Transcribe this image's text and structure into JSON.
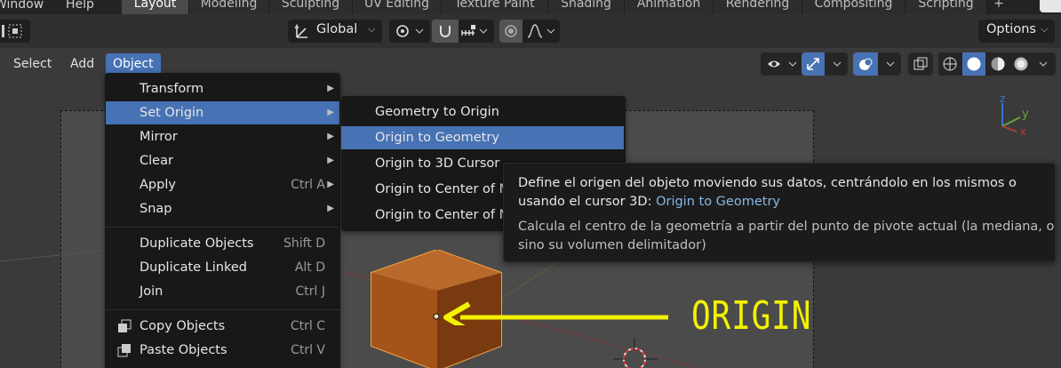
{
  "topbar": {
    "menus": [
      "Window",
      "Help"
    ],
    "workspace_tabs": [
      {
        "label": "Layout",
        "active": true
      },
      {
        "label": "Modeling",
        "active": false
      },
      {
        "label": "Sculpting",
        "active": false
      },
      {
        "label": "UV Editing",
        "active": false
      },
      {
        "label": "Texture Paint",
        "active": false
      },
      {
        "label": "Shading",
        "active": false
      },
      {
        "label": "Animation",
        "active": false
      },
      {
        "label": "Rendering",
        "active": false
      },
      {
        "label": "Compositing",
        "active": false
      },
      {
        "label": "Scripting",
        "active": false
      }
    ],
    "add_tab": "+"
  },
  "header": {
    "orientation": "Global",
    "options": "Options"
  },
  "viewport_menu": [
    "Select",
    "Add",
    "Object"
  ],
  "object_menu": {
    "items": [
      {
        "label": "Transform",
        "shortcut": "",
        "submenu": true
      },
      {
        "label": "Set Origin",
        "shortcut": "",
        "submenu": true,
        "active": true
      },
      {
        "label": "Mirror",
        "shortcut": "",
        "submenu": true
      },
      {
        "label": "Clear",
        "shortcut": "",
        "submenu": true
      },
      {
        "label": "Apply",
        "shortcut": "Ctrl A",
        "submenu": true
      },
      {
        "label": "Snap",
        "shortcut": "",
        "submenu": true
      },
      {
        "label": "Duplicate Objects",
        "shortcut": "Shift D"
      },
      {
        "label": "Duplicate Linked",
        "shortcut": "Alt D"
      },
      {
        "label": "Join",
        "shortcut": "Ctrl J"
      },
      {
        "label": "Copy Objects",
        "shortcut": "Ctrl C",
        "icon": "copy-icon"
      },
      {
        "label": "Paste Objects",
        "shortcut": "Ctrl V",
        "icon": "paste-icon"
      }
    ]
  },
  "set_origin_submenu": {
    "items": [
      {
        "label": "Geometry to Origin"
      },
      {
        "label": "Origin to Geometry",
        "active": true
      },
      {
        "label": "Origin to 3D Cursor"
      },
      {
        "label": "Origin to Center of Mass (Surface)"
      },
      {
        "label": "Origin to Center of Mass (Volume)"
      }
    ]
  },
  "tooltip": {
    "line1": "Define el origen del objeto moviendo sus datos, centrándolo en los mismos o",
    "line2_prefix": "usando el cursor 3D:",
    "line2_python": "Origin to Geometry",
    "desc1": "Calcula el centro de la geometría a partir del punto de pivote actual (la mediana, o",
    "desc2": "sino su volumen delimitador)"
  },
  "annotation": {
    "label": "ORIGIN",
    "color": "#f2f200"
  },
  "gizmo": {
    "axis_x": "x",
    "axis_y": "y",
    "axis_z": "z"
  },
  "colors": {
    "accent": "#4772b3",
    "menu_bg": "#181818",
    "cube": "#b5651d",
    "cube_outline": "#f5a442"
  }
}
